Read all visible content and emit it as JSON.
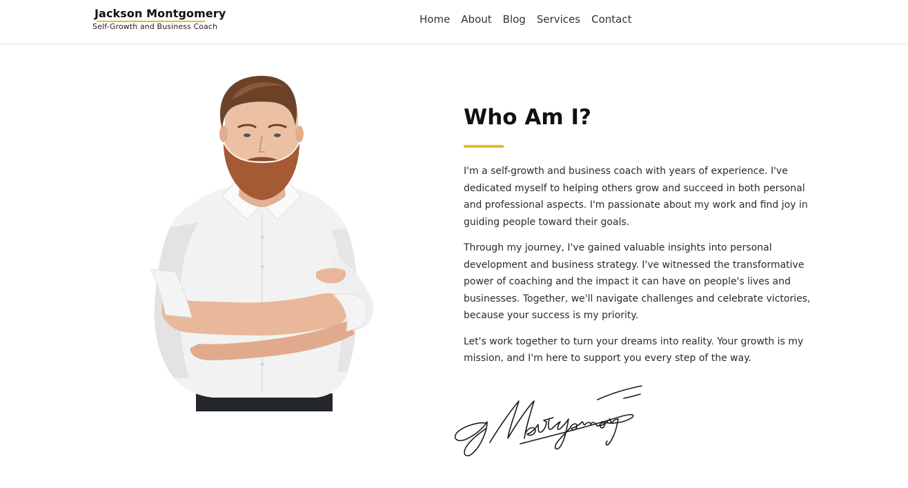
{
  "header": {
    "brand_name": "Jackson Montgomery",
    "brand_tagline": "Self-Growth and Business Coach",
    "nav": [
      "Home",
      "About",
      "Blog",
      "Services",
      "Contact"
    ]
  },
  "about": {
    "title": "Who Am I?",
    "paragraphs": [
      "I'm a self-growth and business coach with years of experience. I've dedicated myself to helping others grow and succeed in both personal and professional aspects. I'm passionate about my work and find joy in guiding people toward their goals.",
      "Through my journey, I've gained valuable insights into personal development and business strategy. I've witnessed the transformative power of coaching and the impact it can have on people's lives and businesses. Together, we'll navigate challenges and celebrate victories, because your success is my priority.",
      "Let's work together to turn your dreams into reality. Your growth is my mission, and I'm here to support you every step of the way."
    ],
    "signature_text": "J Montgomery"
  },
  "colors": {
    "accent": "#e9b824",
    "text": "#2a2a2a",
    "heading": "#111111"
  },
  "icons": {
    "portrait": "man-arms-crossed-photo",
    "signature": "handwritten-signature"
  }
}
